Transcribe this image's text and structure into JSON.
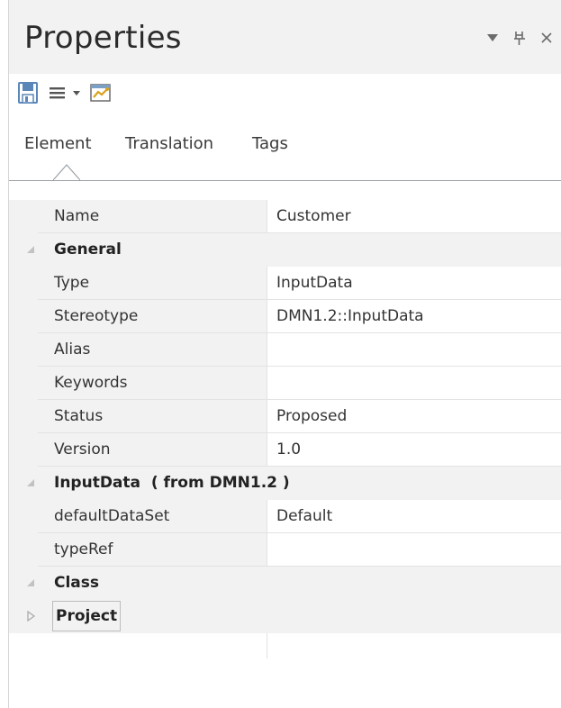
{
  "panel": {
    "title": "Properties",
    "controls": {
      "dropdown": "▼",
      "pin": "⊥",
      "close": "✕"
    }
  },
  "toolbar": {
    "save_icon": "save-icon",
    "menu_icon": "hamburger-menu-icon",
    "menu_dropdown": "▾",
    "properties_icon": "properties-dialog-icon"
  },
  "tabs": [
    {
      "label": "Element",
      "active": true
    },
    {
      "label": "Translation",
      "active": false
    },
    {
      "label": "Tags",
      "active": false
    }
  ],
  "grid": {
    "name_row": {
      "label": "Name",
      "value": "Customer"
    },
    "groups": {
      "general": "General",
      "inputdata": "InputData  ( from DMN1.2 )",
      "class": "Class",
      "project": "Project"
    },
    "general_rows": [
      {
        "label": "Type",
        "value": "InputData"
      },
      {
        "label": "Stereotype",
        "value": "DMN1.2::InputData"
      },
      {
        "label": "Alias",
        "value": ""
      },
      {
        "label": "Keywords",
        "value": ""
      },
      {
        "label": "Status",
        "value": "Proposed"
      },
      {
        "label": "Version",
        "value": "1.0"
      }
    ],
    "inputdata_rows": [
      {
        "label": "defaultDataSet",
        "value": "Default"
      },
      {
        "label": "typeRef",
        "value": ""
      }
    ]
  },
  "colors": {
    "header_bg": "#f2f2f2",
    "label_bg": "#f2f2f2",
    "save_icon": "#5b87b8",
    "text": "#333333"
  }
}
